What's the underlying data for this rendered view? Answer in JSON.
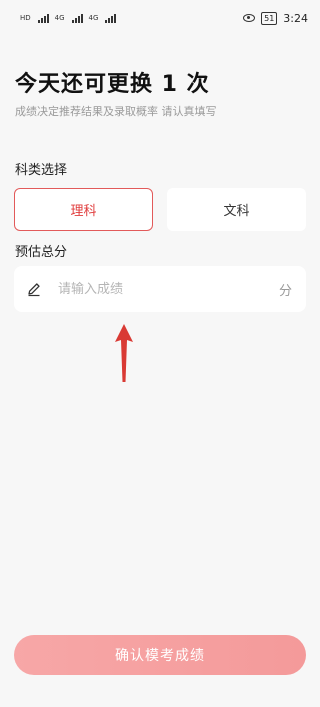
{
  "status_bar": {
    "net_left": "HD",
    "net_mid": "4G",
    "net_right": "4G",
    "battery": "51",
    "time": "3:24"
  },
  "header": {
    "title": "今天还可更换 1 次",
    "subtitle": "成绩决定推荐结果及录取概率  请认真填写"
  },
  "subject": {
    "label": "科类选择",
    "options": [
      {
        "label": "理科",
        "selected": true
      },
      {
        "label": "文科",
        "selected": false
      }
    ],
    "accent_color": "#e03c3c"
  },
  "score": {
    "label": "预估总分",
    "placeholder": "请输入成绩",
    "value": "",
    "unit": "分"
  },
  "annotation": {
    "icon": "red-up-arrow",
    "color": "#d93a34"
  },
  "actions": {
    "confirm_label": "确认模考成绩",
    "confirm_color": "#f49a9a"
  }
}
